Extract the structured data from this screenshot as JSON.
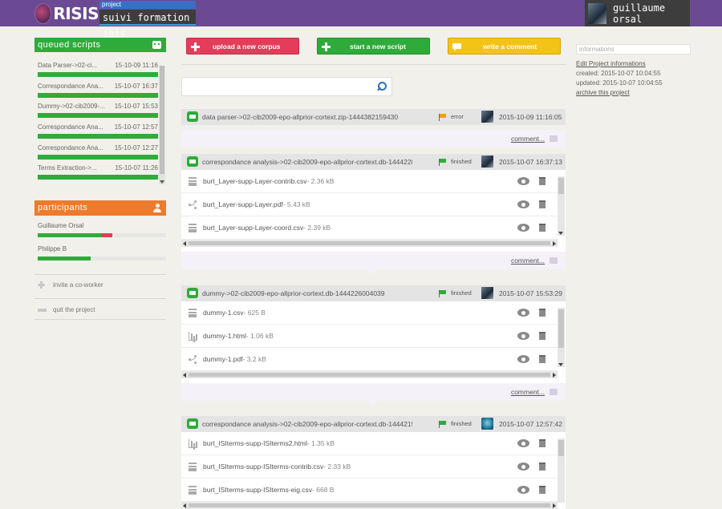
{
  "header": {
    "logo_text": "RISIS",
    "project_tag": "project",
    "project_name": "suivi formation ibis",
    "user_name": "guillaume orsal"
  },
  "queued": {
    "title": "queued scripts",
    "items": [
      {
        "name": "Data Parser->02-ci...",
        "date": "15-10-09 11:16"
      },
      {
        "name": "Correspondance Ana...",
        "date": "15-10-07 16:37"
      },
      {
        "name": "Dummy->02-cib2009-...",
        "date": "15-10-07 15:53"
      },
      {
        "name": "Correspondance Ana...",
        "date": "15-10-07 12:57"
      },
      {
        "name": "Correspondance Ana...",
        "date": "15-10-07 12:27"
      },
      {
        "name": "Terms Extraction->...",
        "date": "15-10-07 11:26"
      }
    ]
  },
  "participants": {
    "title": "participants",
    "people": [
      {
        "name": "Guillaume Orsal",
        "green": 0.5,
        "red": 0.08
      },
      {
        "name": "Philippe B",
        "green": 0.41,
        "red": 0
      }
    ],
    "invite_label": "invite a co-worker",
    "quit_label": "quit the project"
  },
  "actions": {
    "upload_label": "upload a new corpus",
    "script_label": "start a new script",
    "comment_label": "write a comment"
  },
  "search": {
    "value": "",
    "placeholder": ""
  },
  "scripts": [
    {
      "title": "data parser->02-cib2009-epo-allprior-cortext.zip-1444382159430",
      "status": "error",
      "date": "2015-10-09 11:16:05",
      "files": [],
      "comment_label": "comment..."
    },
    {
      "title": "correspondance analysis->02-cib2009-epo-allprior-cortext.db-14442286...",
      "status": "finished",
      "date": "2015-10-07 16:37:13",
      "files": [
        {
          "icon": "document-icon",
          "name": "burt_Layer-supp-Layer-contrib.csv",
          "size": "- 2.36 kB"
        },
        {
          "icon": "share-icon",
          "name": "burt_Layer-supp-Layer.pdf",
          "size": "- 5.43 kB"
        },
        {
          "icon": "document-icon",
          "name": "burt_Layer-supp-Layer-coord.csv",
          "size": "- 2.39 kB"
        }
      ],
      "comment_label": "comment..."
    },
    {
      "title": "dummy->02-cib2009-epo-allprior-cortext.db-1444226004039",
      "status": "finished",
      "date": "2015-10-07 15:53:29",
      "files": [
        {
          "icon": "document-icon",
          "name": "dummy-1.csv",
          "size": "- 625 B"
        },
        {
          "icon": "chart-icon",
          "name": "dummy-1.html",
          "size": "- 1.06 kB"
        },
        {
          "icon": "share-icon",
          "name": "dummy-1.pdf",
          "size": "- 3.2 kB"
        }
      ],
      "comment_label": "comment..."
    },
    {
      "title": "correspondance analysis->02-cib2009-epo-allprior-cortext.db-14442154...",
      "status": "finished",
      "date": "2015-10-07 12:57:42",
      "files": [
        {
          "icon": "chart-icon",
          "name": "burt_ISIterms-supp-ISIterms2.html",
          "size": "- 1.35 kB"
        },
        {
          "icon": "document-icon",
          "name": "burt_ISIterms-supp-ISIterms-contrib.csv",
          "size": "- 2.33 kB"
        },
        {
          "icon": "document-icon",
          "name": "burt_ISIterms-supp-ISIterms-eig.csv",
          "size": "- 668 B"
        }
      ],
      "comment_label": "comment..."
    }
  ],
  "info": {
    "title": "informations",
    "edit_link": "Edit Project informations",
    "created": "created: 2015-10-07 10:04:55",
    "updated": "updated: 2015-10-07 10:04:55",
    "archive_link": "archive this project"
  },
  "colors": {
    "header": "#6c4a93",
    "green": "#2eab3a",
    "red": "#e23d5a",
    "orange": "#ef7a2a",
    "yellow": "#f4c318",
    "blue": "#3a6fc4"
  }
}
